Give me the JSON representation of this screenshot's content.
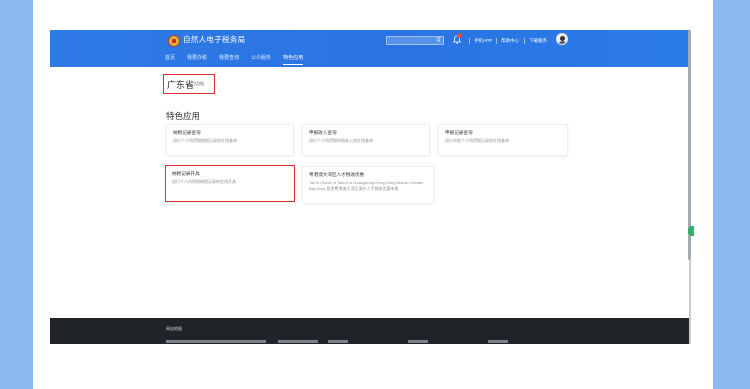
{
  "header": {
    "site_title": "自然人电子税务局",
    "search_button": "Q",
    "links": [
      "手机APP",
      "帮助中心",
      "下载服务"
    ]
  },
  "nav": {
    "items": [
      {
        "label": "首页",
        "active": false
      },
      {
        "label": "我要办税",
        "active": false
      },
      {
        "label": "我要查询",
        "active": false
      },
      {
        "label": "公众服务",
        "active": false
      },
      {
        "label": "特色应用",
        "active": true
      }
    ]
  },
  "main": {
    "province": "广东省",
    "province_tag": "[切换]",
    "section_title": "特色应用",
    "cards": [
      {
        "title": "纳税记录查询",
        "desc": "进行个人所得税纳税记录的在线查询"
      },
      {
        "title": "申报收入查询",
        "desc": "进行个人所得税申报收入的在线查询"
      },
      {
        "title": "申报记录查询",
        "desc": "进行申报个人所得税记录的在线查询"
      },
      {
        "title": "纳税记录开具",
        "desc": "进行个人所得税纳税记录的在线开具"
      },
      {
        "title": "粤港澳大湾区人才税收优惠",
        "desc": "Tax E-Check of Talent in Guangdong-Hong Kong-Macao Greater Bay Area 投资粤港澳大湾区境外人才税收优惠申报"
      }
    ]
  },
  "footer": {
    "title": "网站地图"
  },
  "colors": {
    "header_blue": "#2a73e3",
    "highlight_red": "#e02d2d",
    "footer_dark": "#1f2429",
    "side_blue": "#8ab8f0"
  }
}
